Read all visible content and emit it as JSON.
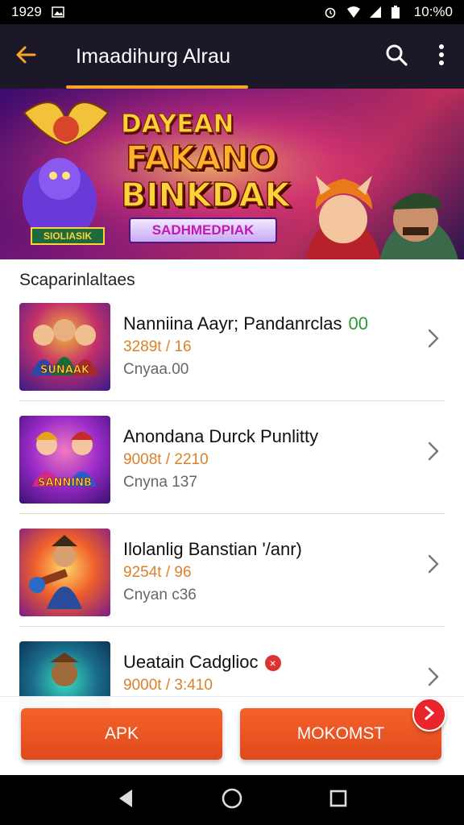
{
  "status_bar": {
    "time": "1929",
    "clock_right": "10:%0",
    "icons": [
      "gallery-icon",
      "alarm-icon",
      "wifi-icon",
      "signal-icon",
      "battery-icon"
    ]
  },
  "app_bar": {
    "title": "Imaadihurg Alrau",
    "icons": [
      "back-arrow-icon",
      "search-icon",
      "more-vert-icon"
    ]
  },
  "banner": {
    "line1": "DAYEAN",
    "line2": "FAKANO",
    "line3": "BINKDAK",
    "ribbon": "SADHMEDPIAK",
    "badge": "SIOLIASIK"
  },
  "section": {
    "title": "Scaparinlaltaes"
  },
  "items": [
    {
      "title": "Nanniina Aayr; Pandanrclas",
      "tag": "00",
      "price": "3289t / 16",
      "subtitle": "Cnyaa.00",
      "thumb_caption": "SUNAAK"
    },
    {
      "title": "Anondana Durck Punlitty",
      "price": "9008t / 2210",
      "subtitle": "Cnyna 137",
      "thumb_caption": "SANNINB"
    },
    {
      "title": "Ilolanlig Banstian  '/anr)",
      "price": "9254t / 96",
      "subtitle": "Cnyan c36",
      "thumb_caption": ""
    },
    {
      "title": "Ueatain Cadglioc",
      "price": "9000t / 3:410",
      "subtitle": "",
      "thumb_caption": ""
    }
  ],
  "actions": {
    "apk_label": "APK",
    "secondary_label": "MOKOMST"
  },
  "colors": {
    "accent_orange": "#f25a22",
    "app_bar_bg": "#1c1828",
    "price_color": "#d9822b",
    "tag_green": "#2a9a3a",
    "fab_red": "#e8242c"
  }
}
